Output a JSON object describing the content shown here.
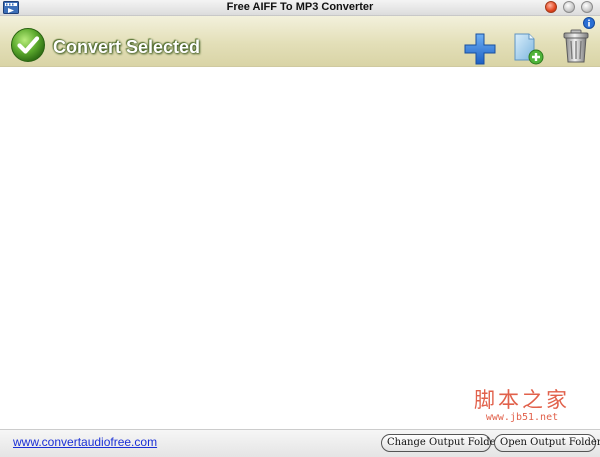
{
  "window": {
    "title": "Free AIFF To MP3 Converter"
  },
  "toolbar": {
    "convert_label": "Convert Selected",
    "icons": [
      "check-icon",
      "plus-icon",
      "add-folder-icon",
      "trash-icon",
      "info-icon"
    ]
  },
  "file_list": {
    "watermark_main": "脚本之家",
    "watermark_url": "www.jb51.net"
  },
  "statusbar": {
    "link_text": "www.convertaudiofree.com",
    "change_folder_label": "Change Output Folder",
    "open_folder_label": "Open Output Folder"
  },
  "colors": {
    "toolbar_bg": "#e3dfb8",
    "convert_green": "#5aa82c",
    "add_blue": "#2e7ad8",
    "link_blue": "#1a2fd6",
    "close_red": "#e2461f",
    "watermark_red": "#e1614b"
  }
}
